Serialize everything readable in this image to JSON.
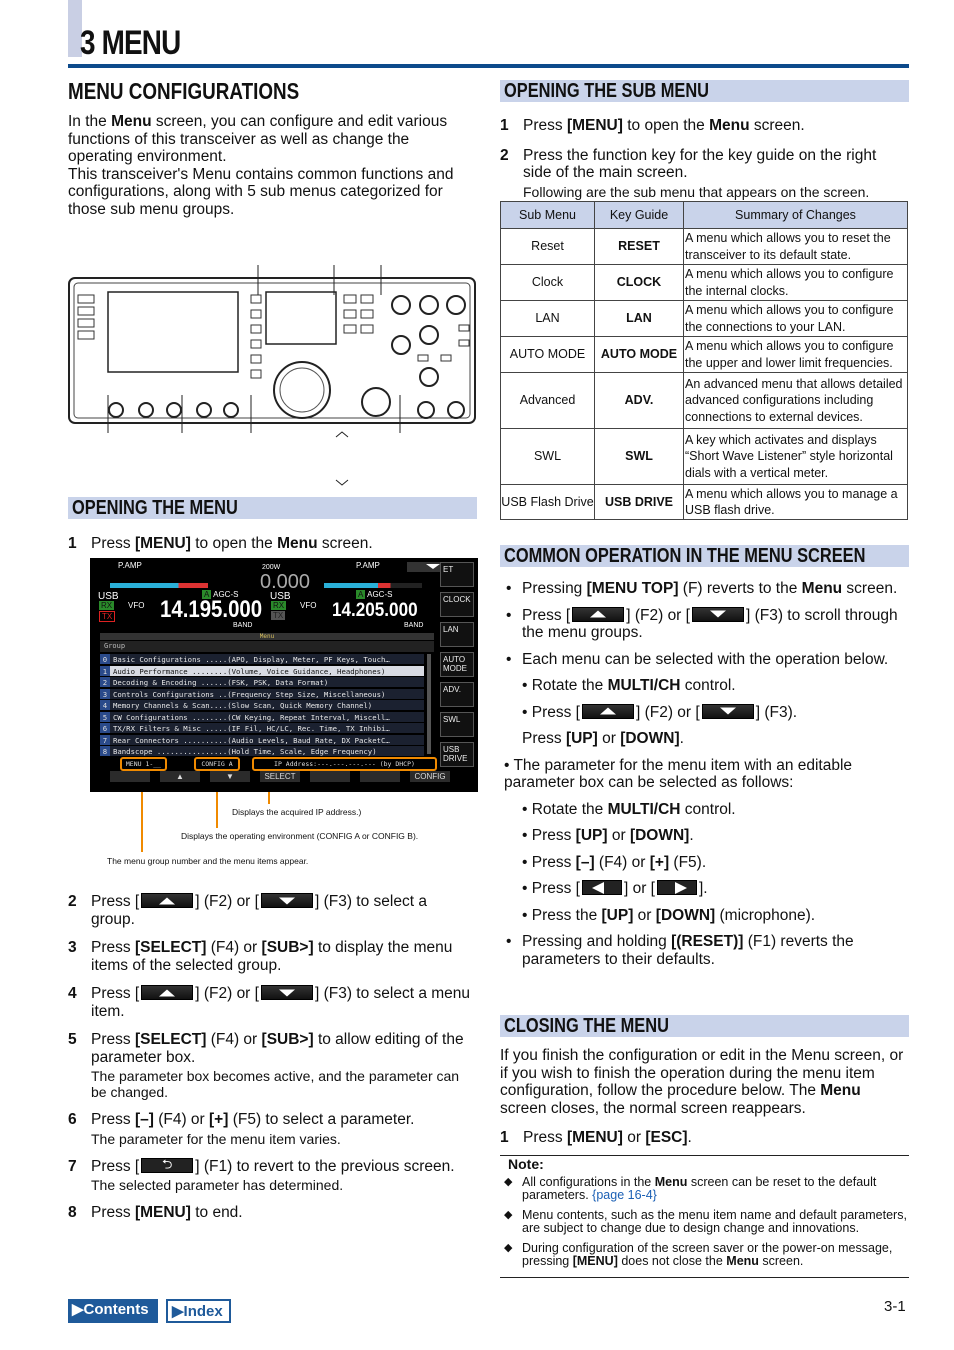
{
  "chapter": "3 MENU",
  "colors": {
    "accent": "#0d4a8b",
    "section_bar": "#c9d3ea",
    "callout": "#f08a00"
  },
  "left": {
    "title": "MENU CONFIGURATIONS",
    "intro": [
      [
        {
          "t": "In the "
        },
        {
          "t": "Menu",
          "b": 1
        },
        {
          "t": " screen, you can configure and edit various functions of this transceiver as well as change the operating environment."
        }
      ],
      [
        {
          "t": "This transceiver's Menu contains common functions and configurations, along with 5 sub menus categorized for those sub menu groups."
        }
      ]
    ],
    "opening_title": "OPENING THE MENU",
    "step1": {
      "num": "1",
      "segs": [
        {
          "t": "Press "
        },
        {
          "t": "[MENU]",
          "b": 1
        },
        {
          "t": " to open the "
        },
        {
          "t": "Menu",
          "b": 1
        },
        {
          "t": " screen."
        }
      ]
    },
    "screen": {
      "pamp_l": "P.AMP",
      "pamp_r": "P.AMP",
      "power": "200W",
      "meter_val": "0.000",
      "mode_l": "USB",
      "mode_r": "USB",
      "agc_l": "AGC-S",
      "agc_r": "AGC-S",
      "vfo_l": "VFO",
      "vfo_r": "VFO",
      "freq_l": "14.195.000",
      "freq_r": "14.205.000",
      "band_l": "BAND",
      "band_r": "BAND",
      "rx": "RX",
      "tx": "TX",
      "a": "A",
      "menu_title": "Menu",
      "group": "Group",
      "rows": [
        {
          "i": "0",
          "t": "Basic Configurations .....(APO, Display, Meter, PF Keys, Touch…"
        },
        {
          "i": "1",
          "t": "Audio Performance ........(Volume, Voice Guidance, Headphones)"
        },
        {
          "i": "2",
          "t": "Decoding & Encoding ......(FSK, PSK, Data Format)"
        },
        {
          "i": "3",
          "t": "Controls Configurations ..(Frequency Step Size, Miscellaneous)"
        },
        {
          "i": "4",
          "t": "Memory Channels & Scan....(Slow Scan, Quick Memory Channel)"
        },
        {
          "i": "5",
          "t": "CW Configurations ........(CW Keying, Repeat Interval, Miscell…"
        },
        {
          "i": "6",
          "t": "TX/RX Filters & Misc .....(IF Fil, HC/LC, Rec. Time, TX Inhibi…"
        },
        {
          "i": "7",
          "t": "Rear Connectors ..........(Audio Levels, Baud Rate, DX PacketC…"
        },
        {
          "i": "8",
          "t": "Bandscope ................(Hold Time, Scale, Edge Frequency)"
        }
      ],
      "status_menu": "MENU 1-__",
      "status_config": "CONFIG A",
      "status_ip": "IP Address:---.---.---.--- (by DHCP)",
      "fkeys": [
        "ET",
        "CLOCK",
        "LAN",
        "AUTO MODE",
        "ADV.",
        "SWL",
        "USB DRIVE"
      ],
      "bottom": [
        "",
        "",
        "",
        "SELECT",
        "",
        "",
        "CONFIG"
      ]
    },
    "captions": {
      "ip": "Displays the acquired IP address.)",
      "config": "Displays the operating environment (CONFIG A or CONFIG B).",
      "group": "The menu group number and the menu items appear."
    },
    "steps": [
      {
        "num": "2",
        "segs": [
          {
            "t": "Press ["
          },
          {
            "i": "up"
          },
          {
            "t": "] (F2) or ["
          },
          {
            "i": "down"
          },
          {
            "t": "] (F3) to select a group."
          }
        ]
      },
      {
        "num": "3",
        "segs": [
          {
            "t": "Press "
          },
          {
            "t": "[SELECT]",
            "b": 1
          },
          {
            "t": " (F4) or "
          },
          {
            "t": "[SUB>]",
            "b": 1
          },
          {
            "t": " to display the menu items of the selected group."
          }
        ]
      },
      {
        "num": "4",
        "segs": [
          {
            "t": "Press ["
          },
          {
            "i": "up"
          },
          {
            "t": "] (F2) or ["
          },
          {
            "i": "down"
          },
          {
            "t": "] (F3) to select a menu item."
          }
        ]
      },
      {
        "num": "5",
        "segs": [
          {
            "t": "Press "
          },
          {
            "t": "[SELECT]",
            "b": 1
          },
          {
            "t": " (F4) or "
          },
          {
            "t": "[SUB>]",
            "b": 1
          },
          {
            "t": " to allow editing of the parameter box."
          }
        ],
        "sub": "The parameter box becomes active, and the parameter can be changed."
      },
      {
        "num": "6",
        "segs": [
          {
            "t": "Press "
          },
          {
            "t": "[–]",
            "b": 1
          },
          {
            "t": " (F4) or "
          },
          {
            "t": "[+]",
            "b": 1
          },
          {
            "t": " (F5) to select a parameter."
          }
        ],
        "sub": "The parameter for the menu item varies."
      },
      {
        "num": "7",
        "segs": [
          {
            "t": "Press ["
          },
          {
            "i": "back"
          },
          {
            "t": "] (F1) to revert to the previous screen."
          }
        ],
        "sub": "The selected parameter has determined."
      },
      {
        "num": "8",
        "segs": [
          {
            "t": "Press "
          },
          {
            "t": "[MENU]",
            "b": 1
          },
          {
            "t": " to end."
          }
        ]
      }
    ]
  },
  "right": {
    "sub_title": "OPENING THE SUB MENU",
    "steps": [
      {
        "num": "1",
        "segs": [
          {
            "t": "Press "
          },
          {
            "t": "[MENU]",
            "b": 1
          },
          {
            "t": " to open the "
          },
          {
            "t": "Menu",
            "b": 1
          },
          {
            "t": " screen."
          }
        ]
      },
      {
        "num": "2",
        "segs": [
          {
            "t": "Press the function key for the key guide on the right side of the main screen."
          }
        ],
        "sub": "Following are the sub menu that appears on the screen."
      }
    ],
    "table": {
      "headers": [
        "Sub Menu",
        "Key Guide",
        "Summary of Changes"
      ],
      "rows": [
        {
          "sub": "Reset",
          "key": "RESET",
          "sum": "A menu which allows you to reset the transceiver to its default state."
        },
        {
          "sub": "Clock",
          "key": "CLOCK",
          "sum": "A menu which allows you to configure the internal clocks."
        },
        {
          "sub": "LAN",
          "key": "LAN",
          "sum": "A menu which allows you to configure the connections to your LAN."
        },
        {
          "sub": "AUTO MODE",
          "key": "AUTO MODE",
          "sum": "A menu which allows you to configure the upper and lower limit frequencies."
        },
        {
          "sub": "Advanced",
          "key": "ADV.",
          "sum": "An advanced menu that allows detailed advanced configurations including connections to external devices."
        },
        {
          "sub": "SWL",
          "key": "SWL",
          "sum": "A key which activates and displays “Short Wave Listener” style horizontal dials with a vertical meter."
        },
        {
          "sub": "USB Flash Drive",
          "key": "USB DRIVE",
          "sum": "A menu which allows you to manage a USB flash drive."
        }
      ]
    },
    "common_title": "COMMON OPERATION IN THE MENU SCREEN",
    "common": [
      {
        "k": "b",
        "segs": [
          {
            "t": "Pressing "
          },
          {
            "t": "[MENU TOP]",
            "b": 1
          },
          {
            "t": " (F) reverts to the "
          },
          {
            "t": "Menu",
            "b": 1
          },
          {
            "t": " screen."
          }
        ]
      },
      {
        "k": "b",
        "segs": [
          {
            "t": "Press ["
          },
          {
            "i": "up"
          },
          {
            "t": "] (F2) or ["
          },
          {
            "i": "down"
          },
          {
            "t": "] (F3) to scroll through the menu groups."
          }
        ]
      },
      {
        "k": "b",
        "segs": [
          {
            "t": "Each menu can be selected with the operation below."
          }
        ]
      },
      {
        "k": "s",
        "segs": [
          {
            "t": "• Rotate the "
          },
          {
            "t": "MULTI/CH",
            "b": 1
          },
          {
            "t": " control."
          }
        ]
      },
      {
        "k": "s",
        "segs": [
          {
            "t": "• Press ["
          },
          {
            "i": "up"
          },
          {
            "t": "] (F2) or ["
          },
          {
            "i": "down"
          },
          {
            "t": "] (F3)."
          }
        ]
      },
      {
        "k": "s",
        "segs": [
          {
            "t": "Press "
          },
          {
            "t": "[UP]",
            "b": 1
          },
          {
            "t": " or "
          },
          {
            "t": "[DOWN]",
            "b": 1
          },
          {
            "t": "."
          }
        ]
      },
      {
        "k": "p",
        "segs": [
          {
            "t": "• The parameter for the menu item with an editable parameter box can be selected as follows:"
          }
        ]
      },
      {
        "k": "s",
        "segs": [
          {
            "t": "• Rotate the "
          },
          {
            "t": "MULTI/CH",
            "b": 1
          },
          {
            "t": " control."
          }
        ]
      },
      {
        "k": "s",
        "segs": [
          {
            "t": "• Press "
          },
          {
            "t": "[UP]",
            "b": 1
          },
          {
            "t": " or "
          },
          {
            "t": "[DOWN]",
            "b": 1
          },
          {
            "t": "."
          }
        ]
      },
      {
        "k": "s",
        "segs": [
          {
            "t": "• Press "
          },
          {
            "t": "[–]",
            "b": 1
          },
          {
            "t": " (F4) or "
          },
          {
            "t": "[+]",
            "b": 1
          },
          {
            "t": " (F5)."
          }
        ]
      },
      {
        "k": "s",
        "segs": [
          {
            "t": "• Press ["
          },
          {
            "i": "left"
          },
          {
            "t": "] or ["
          },
          {
            "i": "right"
          },
          {
            "t": "]."
          }
        ]
      },
      {
        "k": "s",
        "segs": [
          {
            "t": "• Press the "
          },
          {
            "t": "[UP]",
            "b": 1
          },
          {
            "t": " or "
          },
          {
            "t": "[DOWN]",
            "b": 1
          },
          {
            "t": " (microphone)."
          }
        ]
      },
      {
        "k": "b",
        "segs": [
          {
            "t": "Pressing and holding "
          },
          {
            "t": "[(RESET)]",
            "b": 1
          },
          {
            "t": " (F1) reverts the parameters to their defaults."
          }
        ]
      }
    ],
    "closing_title": "CLOSING THE MENU",
    "closing_para": [
      {
        "t": "If you finish the configuration or edit in the Menu screen, or if you wish to finish the operation during the menu item configuration, follow the procedure below. The "
      },
      {
        "t": "Menu",
        "b": 1
      },
      {
        "t": " screen closes, the normal screen reappears."
      }
    ],
    "closing_step": {
      "num": "1",
      "segs": [
        {
          "t": "Press "
        },
        {
          "t": "[MENU]",
          "b": 1
        },
        {
          "t": " or "
        },
        {
          "t": "[ESC]",
          "b": 1
        },
        {
          "t": "."
        }
      ]
    },
    "note_title": "Note:",
    "notes": [
      [
        {
          "t": "All configurations in the "
        },
        {
          "t": "Menu",
          "b": 1
        },
        {
          "t": " screen can be reset to the default parameters. "
        },
        {
          "t": "{page 16-4}",
          "l": 1
        }
      ],
      [
        {
          "t": "Menu contents, such as the menu item name and default parameters, are subject to change due to design change and innovations."
        }
      ],
      [
        {
          "t": "During configuration of the screen saver or the power-on message, pressing "
        },
        {
          "t": "[MENU]",
          "b": 1
        },
        {
          "t": " does not close the "
        },
        {
          "t": "Menu",
          "b": 1
        },
        {
          "t": " screen."
        }
      ]
    ]
  },
  "footer": {
    "contents": "Contents",
    "index": "Index",
    "page": "3-1"
  }
}
